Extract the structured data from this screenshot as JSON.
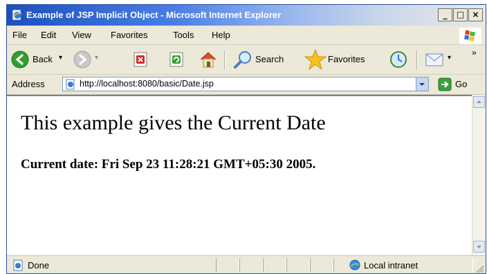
{
  "window": {
    "title": "Example of JSP Implicit Object - Microsoft Internet Explorer",
    "buttons": {
      "minimize": "_",
      "maximize": "□",
      "close": "×"
    }
  },
  "menu": {
    "items": [
      {
        "label": "File"
      },
      {
        "label": "Edit"
      },
      {
        "label": "View"
      },
      {
        "label": "Favorites"
      },
      {
        "label": "Tools"
      },
      {
        "label": "Help"
      }
    ]
  },
  "toolbar": {
    "back_label": "Back",
    "search_label": "Search",
    "favorites_label": "Favorites",
    "overflow": "»",
    "dropdown_glyph": "▾"
  },
  "address": {
    "label": "Address",
    "url": "http://localhost:8080/basic/Date.jsp",
    "go_label": "Go"
  },
  "page": {
    "heading": "This example gives the Current Date",
    "current_date": "Current date: Fri Sep 23 11:28:21 GMT+05:30 2005."
  },
  "status": {
    "text": "Done",
    "zone": "Local intranet"
  },
  "colors": {
    "titlebar_blue": "#1c50c0",
    "toolbar_bg": "#ece9d8",
    "back_green": "#2fa12f",
    "stop_red": "#d6281f",
    "refresh_green": "#37a23a",
    "star_yellow": "#f7c21a"
  },
  "icons": {
    "title": "ie-page-icon",
    "back": "back-arrow-icon",
    "forward": "forward-arrow-icon",
    "stop": "stop-icon",
    "refresh": "refresh-icon",
    "home": "home-icon",
    "search": "search-icon",
    "favorites": "star-icon",
    "history": "history-icon",
    "mail": "mail-icon",
    "go": "go-arrow-icon",
    "status_page": "page-done-icon",
    "zone": "local-intranet-icon"
  }
}
